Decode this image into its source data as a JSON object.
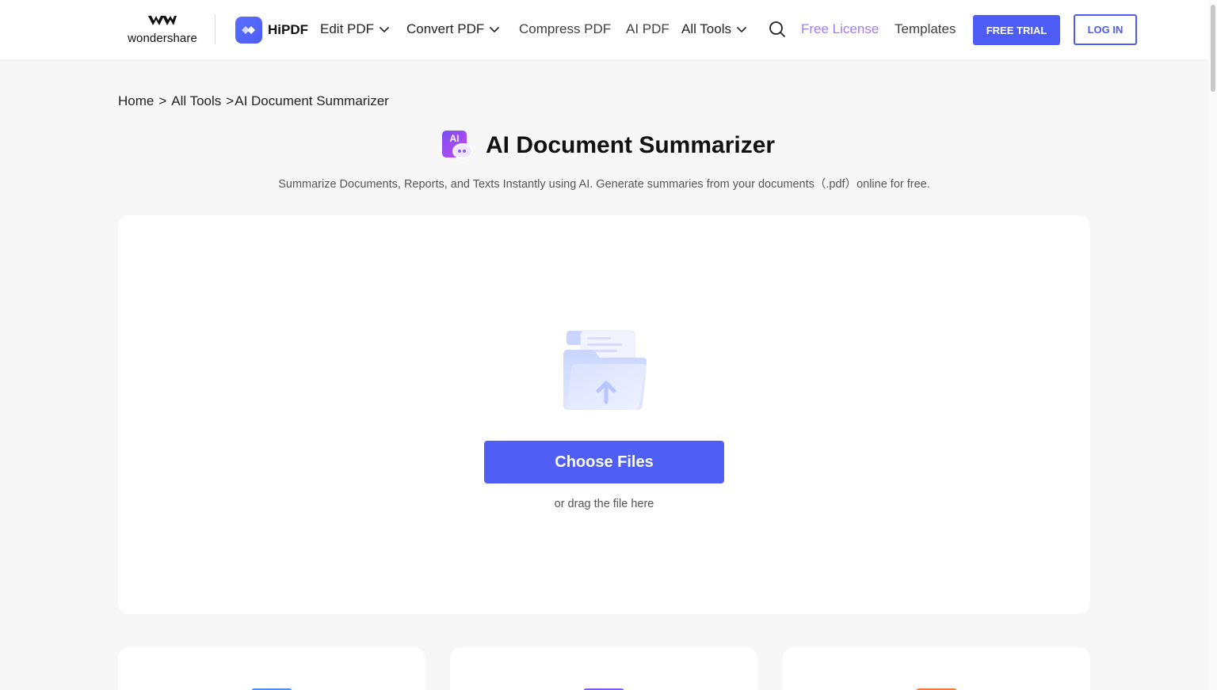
{
  "header": {
    "brand_name": "wondershare",
    "product_name": "HiPDF",
    "nav": {
      "edit_pdf": "Edit PDF",
      "convert_pdf": "Convert PDF",
      "compress_pdf": "Compress PDF",
      "ai_pdf": "AI PDF",
      "all_tools": "All Tools",
      "free_license": "Free License",
      "templates": "Templates"
    },
    "free_trial_label": "FREE TRIAL",
    "login_label": "LOG IN"
  },
  "breadcrumb": {
    "home": "Home",
    "sep1": ">",
    "all_tools": "All Tools",
    "sep2": ">",
    "current": "AI Document Summarizer"
  },
  "page": {
    "icon_text": "AI",
    "title": "AI Document Summarizer",
    "subtitle": "Summarize Documents, Reports, and Texts Instantly using AI. Generate summaries from your documents（.pdf）online for free."
  },
  "upload": {
    "choose_label": "Choose Files",
    "drag_hint": "or drag the file here"
  },
  "colors": {
    "accent": "#4d5cf5",
    "free_license": "#a17cf4",
    "card_icon_1": "#4f8cf7",
    "card_icon_2": "#7a5cf5",
    "card_icon_3": "#f57a3d"
  }
}
